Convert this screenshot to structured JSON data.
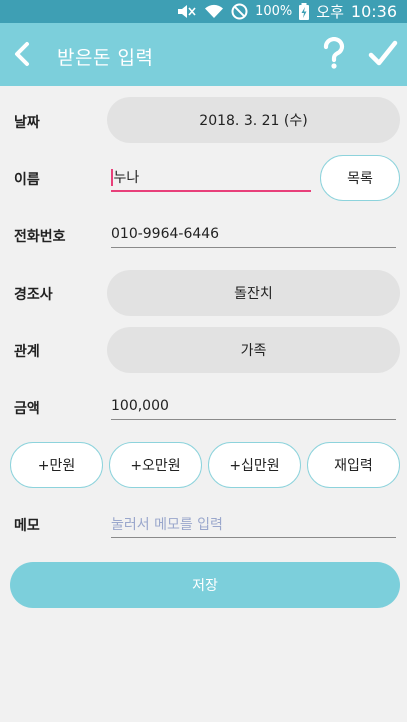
{
  "status_bar": {
    "battery_percent": "100%",
    "ampm": "오후",
    "time": "10:36",
    "icons": [
      "mute-icon",
      "wifi-icon",
      "do-not-disturb-icon",
      "battery-charging-icon"
    ]
  },
  "app_bar": {
    "title": "받은돈 입력",
    "back_icon": "chevron-left-icon",
    "help_icon": "question-mark-icon",
    "done_icon": "checkmark-icon",
    "color": "#7ccfdb"
  },
  "form": {
    "date": {
      "label": "날짜",
      "value": "2018. 3. 21 (수)"
    },
    "name": {
      "label": "이름",
      "value": "누나",
      "list_button": "목록",
      "active_underline_color": "#e8407a"
    },
    "phone": {
      "label": "전화번호",
      "value": "010-9964-6446"
    },
    "event": {
      "label": "경조사",
      "value": "돌잔치"
    },
    "relation": {
      "label": "관계",
      "value": "가족"
    },
    "amount": {
      "label": "금액",
      "value": "100,000"
    },
    "quick_buttons": [
      "+만원",
      "+오만원",
      "+십만원",
      "재입력"
    ],
    "memo": {
      "label": "메모",
      "placeholder": "눌러서 메모를 입력"
    }
  },
  "save_button": {
    "label": "저장"
  }
}
